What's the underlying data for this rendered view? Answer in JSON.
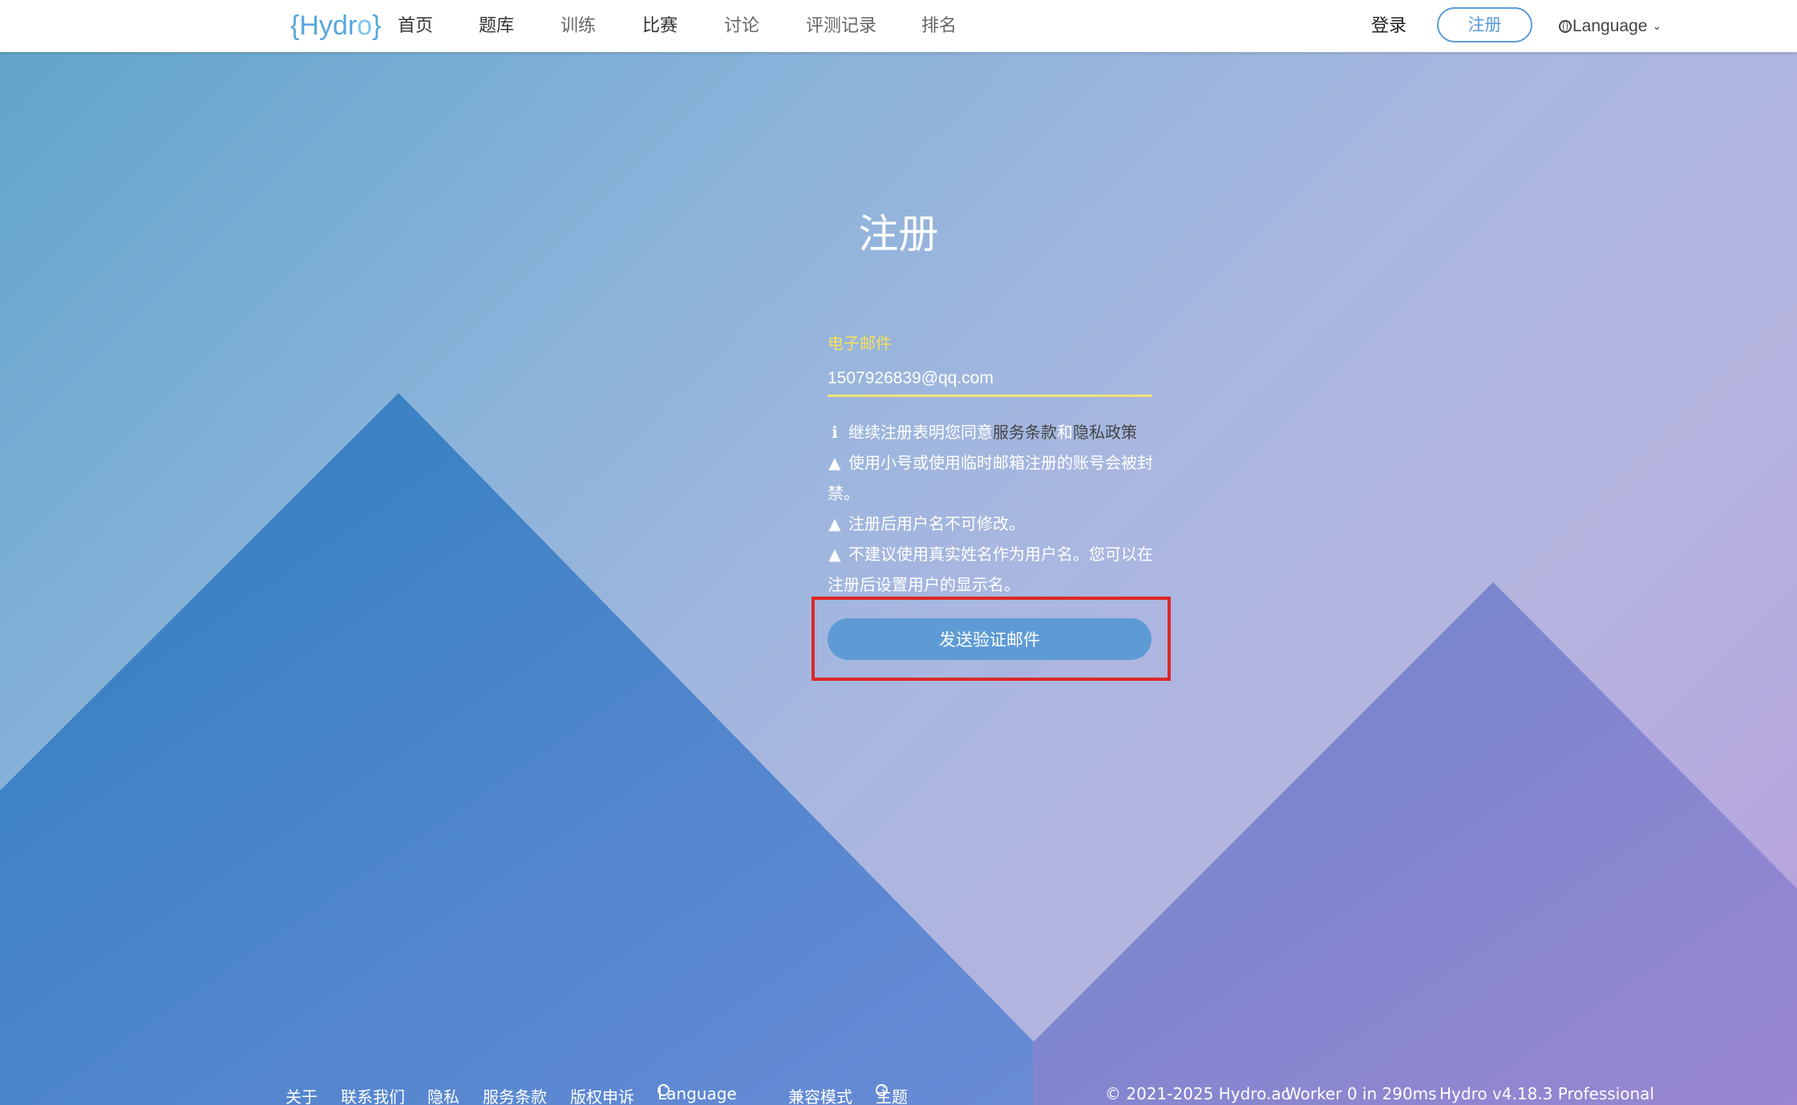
{
  "brand": {
    "logo_text_left": "{Hydr",
    "logo_drop": "o",
    "logo_text_right": "}"
  },
  "nav": {
    "items": [
      {
        "label": "首页"
      },
      {
        "label": "题库"
      },
      {
        "label": "训练"
      },
      {
        "label": "比赛"
      },
      {
        "label": "讨论"
      },
      {
        "label": "评测记录"
      },
      {
        "label": "排名"
      }
    ],
    "login": "登录",
    "register": "注册",
    "language": "Language"
  },
  "form": {
    "title": "注册",
    "email_label": "电子邮件",
    "email_value": "1507926839@qq.com",
    "notes": {
      "agree_prefix": "继续注册表明您同意",
      "terms_link": "服务条款",
      "and": "和",
      "privacy_link": "隐私政策",
      "warn1": "使用小号或使用临时邮箱注册的账号会被封禁。",
      "warn2": "注册后用户名不可修改。",
      "warn3": "不建议使用真实姓名作为用户名。您可以在注册后设置用户的显示名。"
    },
    "submit": "发送验证邮件"
  },
  "footer": {
    "about": "关于",
    "contact": "联系我们",
    "privacy": "隐私",
    "terms": "服务条款",
    "dmca": "版权申诉",
    "language": "Language",
    "compat": "兼容模式",
    "theme": "主题",
    "copyright": "© 2021-2025 Hydro.ac",
    "worker": "Worker 0 in 290ms",
    "version": "Hydro v4.18.3 Professional"
  },
  "colors": {
    "accent": "#5b9bd5",
    "field_label": "#f6e05e",
    "highlight": "#dc2626"
  },
  "icons": {
    "info": "info-icon",
    "warning": "warning-icon",
    "globe": "globe-icon",
    "caret": "chevron-down-icon"
  }
}
